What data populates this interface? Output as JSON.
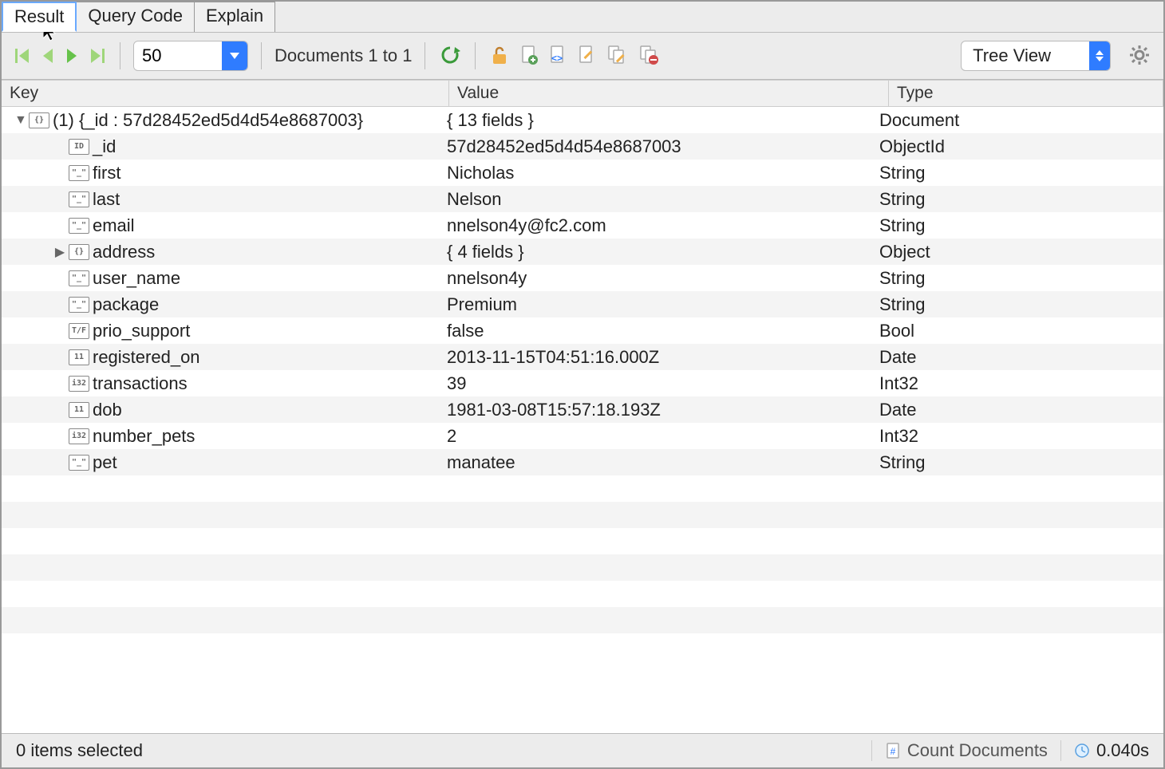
{
  "tabs": [
    "Result",
    "Query Code",
    "Explain"
  ],
  "activeTab": 0,
  "toolbar": {
    "pageSize": "50",
    "docLabel": "Documents 1 to 1",
    "viewMode": "Tree View"
  },
  "columns": [
    "Key",
    "Value",
    "Type"
  ],
  "rows": [
    {
      "indent": 0,
      "disclosure": "down",
      "icon": "{}",
      "key": "(1) {_id : 57d28452ed5d4d54e8687003}",
      "value": "{ 13 fields }",
      "type": "Document"
    },
    {
      "indent": 1,
      "disclosure": "",
      "icon": "ID",
      "key": "_id",
      "value": "57d28452ed5d4d54e8687003",
      "type": "ObjectId"
    },
    {
      "indent": 1,
      "disclosure": "",
      "icon": "\"_\"",
      "key": "first",
      "value": "Nicholas",
      "type": "String"
    },
    {
      "indent": 1,
      "disclosure": "",
      "icon": "\"_\"",
      "key": "last",
      "value": "Nelson",
      "type": "String"
    },
    {
      "indent": 1,
      "disclosure": "",
      "icon": "\"_\"",
      "key": "email",
      "value": "nnelson4y@fc2.com",
      "type": "String"
    },
    {
      "indent": 1,
      "disclosure": "right",
      "icon": "{}",
      "key": "address",
      "value": "{ 4 fields }",
      "type": "Object"
    },
    {
      "indent": 1,
      "disclosure": "",
      "icon": "\"_\"",
      "key": "user_name",
      "value": "nnelson4y",
      "type": "String"
    },
    {
      "indent": 1,
      "disclosure": "",
      "icon": "\"_\"",
      "key": "package",
      "value": "Premium",
      "type": "String"
    },
    {
      "indent": 1,
      "disclosure": "",
      "icon": "T/F",
      "key": "prio_support",
      "value": "false",
      "type": "Bool"
    },
    {
      "indent": 1,
      "disclosure": "",
      "icon": "11",
      "key": "registered_on",
      "value": "2013-11-15T04:51:16.000Z",
      "type": "Date"
    },
    {
      "indent": 1,
      "disclosure": "",
      "icon": "i32",
      "key": "transactions",
      "value": "39",
      "type": "Int32"
    },
    {
      "indent": 1,
      "disclosure": "",
      "icon": "11",
      "key": "dob",
      "value": "1981-03-08T15:57:18.193Z",
      "type": "Date"
    },
    {
      "indent": 1,
      "disclosure": "",
      "icon": "i32",
      "key": "number_pets",
      "value": "2",
      "type": "Int32"
    },
    {
      "indent": 1,
      "disclosure": "",
      "icon": "\"_\"",
      "key": "pet",
      "value": "manatee",
      "type": "String"
    }
  ],
  "emptyRows": 7,
  "status": {
    "selection": "0 items selected",
    "countLabel": "Count Documents",
    "time": "0.040s"
  }
}
